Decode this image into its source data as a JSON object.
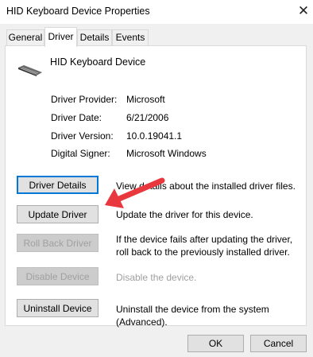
{
  "window": {
    "title": "HID Keyboard Device Properties",
    "close_glyph": "✕"
  },
  "tabs": [
    {
      "label": "General",
      "active": false
    },
    {
      "label": "Driver",
      "active": true
    },
    {
      "label": "Details",
      "active": false
    },
    {
      "label": "Events",
      "active": false
    }
  ],
  "device": {
    "icon": "keyboard-icon",
    "name": "HID Keyboard Device"
  },
  "properties": [
    {
      "label": "Driver Provider:",
      "value": "Microsoft"
    },
    {
      "label": "Driver Date:",
      "value": "6/21/2006"
    },
    {
      "label": "Driver Version:",
      "value": "10.0.19041.1"
    },
    {
      "label": "Digital Signer:",
      "value": "Microsoft Windows"
    }
  ],
  "actions": [
    {
      "label": "Driver Details",
      "description": "View details about the installed driver files.",
      "enabled": true,
      "focused": true
    },
    {
      "label": "Update Driver",
      "description": "Update the driver for this device.",
      "enabled": true,
      "focused": false
    },
    {
      "label": "Roll Back Driver",
      "description": "If the device fails after updating the driver, roll back to the previously installed driver.",
      "enabled": true,
      "focused": false
    },
    {
      "label": "Disable Device",
      "description": "Disable the device.",
      "enabled": false,
      "focused": false
    },
    {
      "label": "Uninstall Device",
      "description": "Uninstall the device from the system (Advanced).",
      "enabled": true,
      "focused": false
    }
  ],
  "footer": {
    "ok_label": "OK",
    "cancel_label": "Cancel"
  },
  "annotation": {
    "arrow_color": "#e8383d"
  }
}
